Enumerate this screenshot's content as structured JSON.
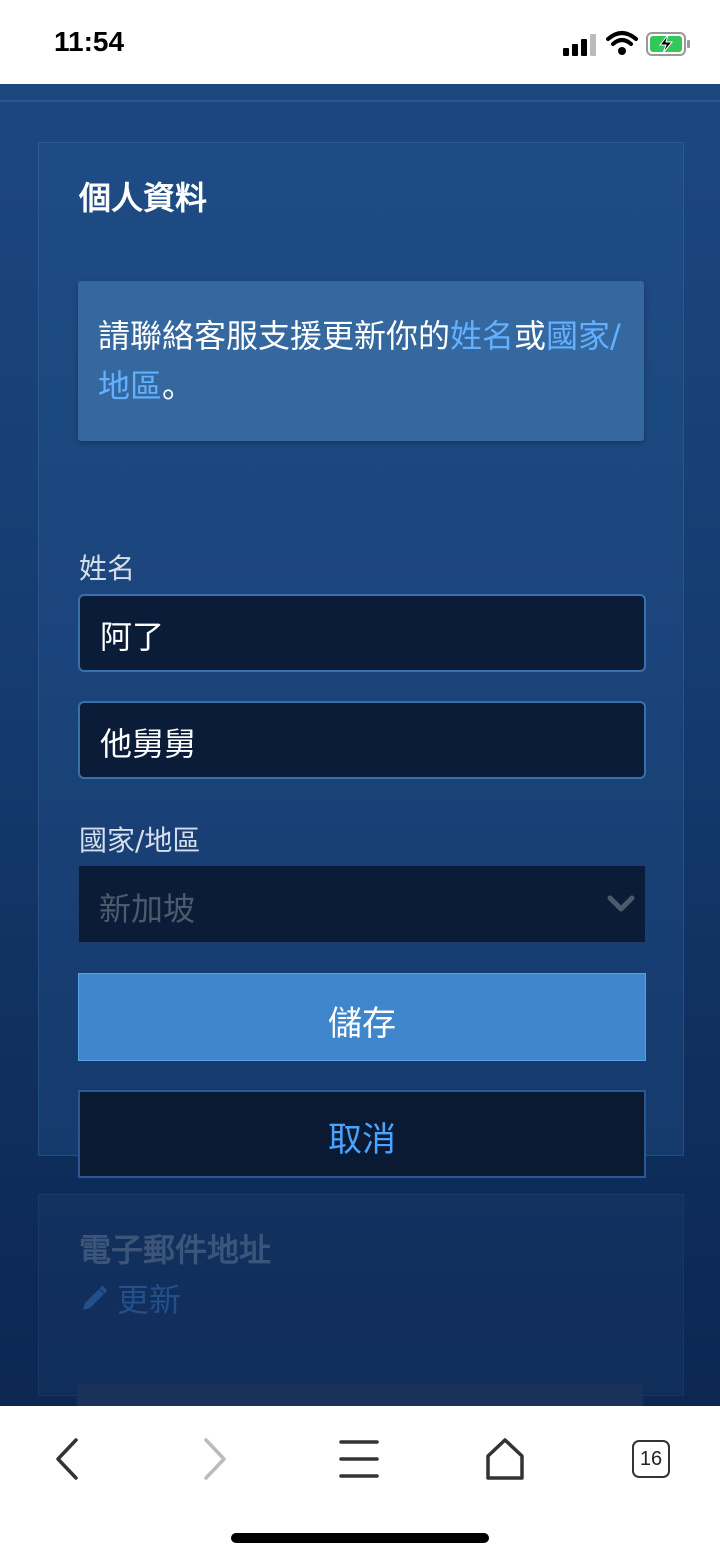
{
  "status_bar": {
    "time": "11:54"
  },
  "profile_card": {
    "title": "個人資料",
    "notice": {
      "text_before": "請聯絡客服支援更新你的",
      "link_name": "姓名",
      "text_middle": "或",
      "link_country": "國家/地區",
      "text_after": "。"
    },
    "name_label": "姓名",
    "first_name_value": "阿了",
    "last_name_value": "他舅舅",
    "country_label": "國家/地區",
    "country_value": "新加坡",
    "save_label": "儲存",
    "cancel_label": "取消"
  },
  "email_card": {
    "title": "電子郵件地址",
    "update_label": "更新"
  },
  "browser_bar": {
    "tab_count": "16"
  },
  "colors": {
    "accent": "#3f86cc",
    "link": "#62b0ff",
    "field_bg": "#0b1c38"
  }
}
